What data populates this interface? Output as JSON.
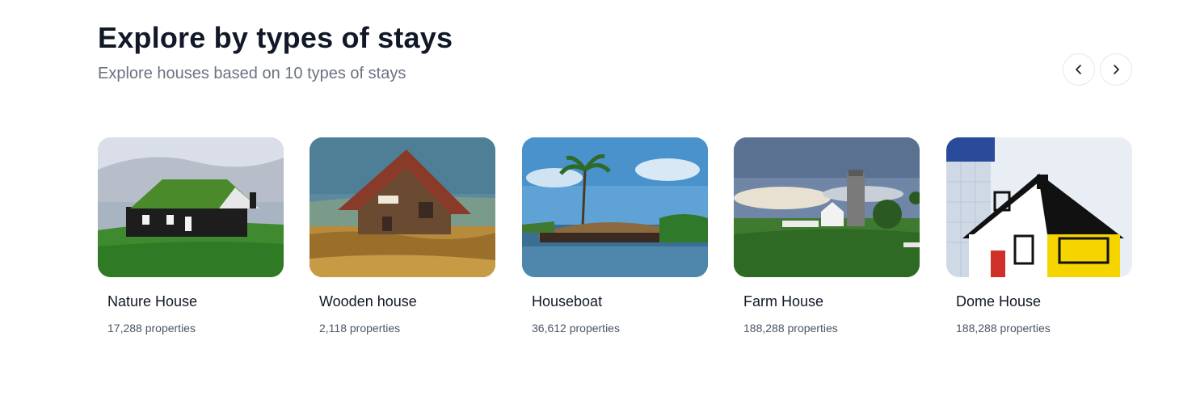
{
  "header": {
    "title": "Explore by types of stays",
    "subtitle": "Explore houses based on 10 types of stays"
  },
  "navigation": {
    "prev_icon": "chevron-left-icon",
    "next_icon": "chevron-right-icon"
  },
  "cards": [
    {
      "title": "Nature House",
      "count": "17,288 properties"
    },
    {
      "title": "Wooden house",
      "count": "2,118 properties"
    },
    {
      "title": "Houseboat",
      "count": "36,612 properties"
    },
    {
      "title": "Farm House",
      "count": "188,288 properties"
    },
    {
      "title": "Dome House",
      "count": "188,288 properties"
    }
  ],
  "colors": {
    "title": "#111827",
    "subtitle": "#6b7280",
    "border": "#e5e7eb"
  }
}
